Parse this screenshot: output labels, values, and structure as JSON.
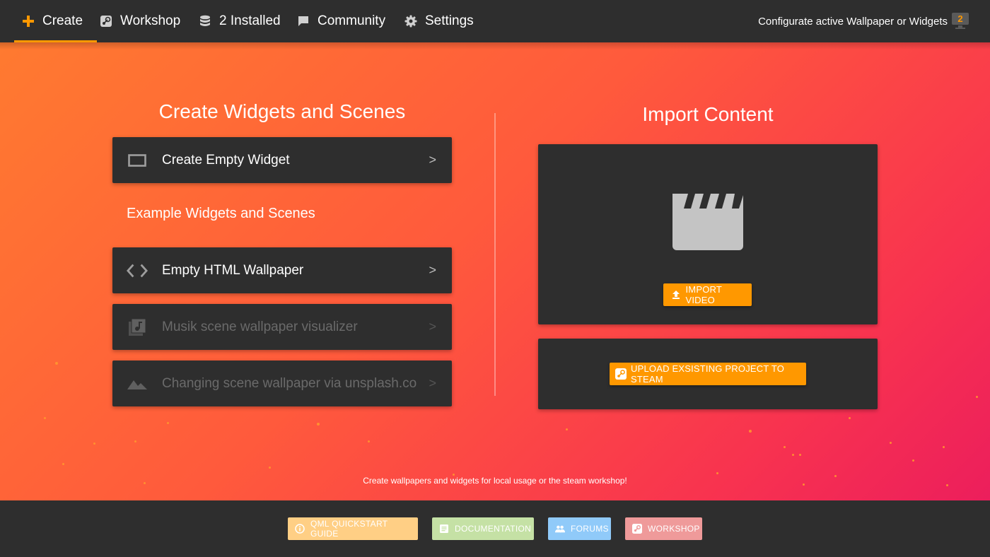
{
  "nav": {
    "items": [
      {
        "label": "Create",
        "icon": "plus-icon",
        "active": true
      },
      {
        "label": "Workshop",
        "icon": "steam-icon",
        "active": false
      },
      {
        "label": "2 Installed",
        "icon": "database-icon",
        "active": false
      },
      {
        "label": "Community",
        "icon": "chat-icon",
        "active": false
      },
      {
        "label": "Settings",
        "icon": "gear-icon",
        "active": false
      }
    ],
    "configure_label": "Configurate active Wallpaper or Widgets",
    "monitor_count": "2"
  },
  "left": {
    "title": "Create Widgets and Scenes",
    "create_empty": {
      "label": "Create Empty Widget",
      "arrow": ">",
      "icon": "widget-frame-icon"
    },
    "examples_title": "Example Widgets and Scenes",
    "examples": [
      {
        "label": "Empty HTML Wallpaper",
        "arrow": ">",
        "icon": "code-icon",
        "enabled": true
      },
      {
        "label": "Musik scene wallpaper visualizer",
        "arrow": ">",
        "icon": "music-library-icon",
        "enabled": false
      },
      {
        "label": "Changing scene wallpaper via unsplash.co",
        "arrow": ">",
        "icon": "landscape-icon",
        "enabled": false
      }
    ]
  },
  "right": {
    "title": "Import Content",
    "import_video_label": "IMPORT VIDEO",
    "upload_label": "UPLOAD EXSISTING PROJECT TO STEAM"
  },
  "tagline": "Create wallpapers and widgets for local usage or the steam workshop!",
  "footer": {
    "buttons": [
      {
        "label": "QML QUICKSTART GUIDE",
        "icon": "info-icon",
        "color": "#ffcf85"
      },
      {
        "label": "DOCUMENTATION",
        "icon": "document-icon",
        "color": "#c5e1a5"
      },
      {
        "label": "FORUMS",
        "icon": "people-icon",
        "color": "#90caf9"
      },
      {
        "label": "WORKSHOP",
        "icon": "steam-icon",
        "color": "#ef9a9a"
      }
    ]
  },
  "colors": {
    "accent": "#ff9800",
    "panel": "#2e2e2e",
    "gradient_start": "#ff7a30",
    "gradient_end": "#ec1e5c"
  }
}
